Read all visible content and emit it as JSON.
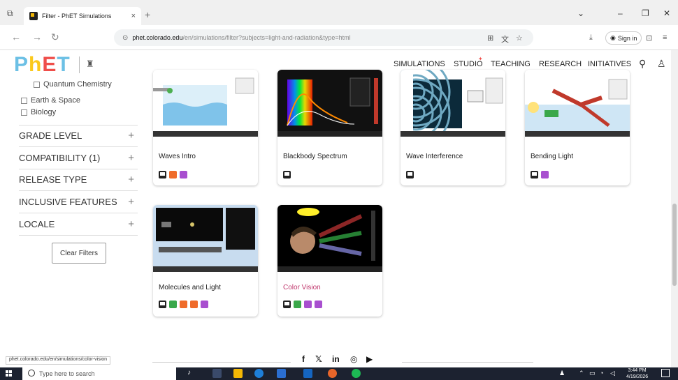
{
  "browser": {
    "tab_title": "Filter - PhET Simulations",
    "tab_close": "×",
    "new_tab": "+",
    "url_domain": "phet.colorado.edu",
    "url_path": "/en/simulations/filter?subjects=light-and-radiation&type=html",
    "sign_in": "Sign in",
    "minimize": "–",
    "restore": "❐",
    "close": "✕"
  },
  "header": {
    "logo_letters": [
      "P",
      "h",
      "E",
      "T"
    ],
    "nav": [
      "SIMULATIONS",
      "STUDIO",
      "TEACHING",
      "RESEARCH",
      "INITIATIVES"
    ]
  },
  "sidebar": {
    "subjects": [
      "Quantum Chemistry",
      "Earth & Space",
      "Biology"
    ],
    "facets": [
      "GRADE LEVEL",
      "COMPATIBILITY (1)",
      "RELEASE TYPE",
      "INCLUSIVE FEATURES",
      "LOCALE"
    ],
    "facet_toggle": "+",
    "clear_filters": "Clear Filters"
  },
  "simulations": [
    {
      "title": "Waves Intro",
      "badges": [
        "html",
        "orange",
        "purple"
      ]
    },
    {
      "title": "Blackbody Spectrum",
      "badges": [
        "html"
      ]
    },
    {
      "title": "Wave Interference",
      "badges": [
        "html"
      ]
    },
    {
      "title": "Bending Light",
      "badges": [
        "html",
        "purple"
      ]
    },
    {
      "title": "Molecules and Light",
      "badges": [
        "html",
        "green",
        "orange",
        "orange",
        "purple"
      ]
    },
    {
      "title": "Color Vision",
      "badges": [
        "html",
        "green",
        "purple",
        "purple"
      ]
    }
  ],
  "footer": {
    "social": [
      "f",
      "𝕏",
      "in",
      "◎",
      "▶"
    ],
    "status_url": "phet.colorado.edu/en/simulations/color-vision"
  },
  "taskbar": {
    "search_placeholder": "Type here to search",
    "time": "3:44 PM",
    "date": "4/19/2026"
  },
  "colors": {
    "accent_pink": "#c0396e",
    "phet_blue": "#6cc0e5",
    "phet_yellow": "#fbc91c",
    "phet_red": "#ef4e4a"
  }
}
